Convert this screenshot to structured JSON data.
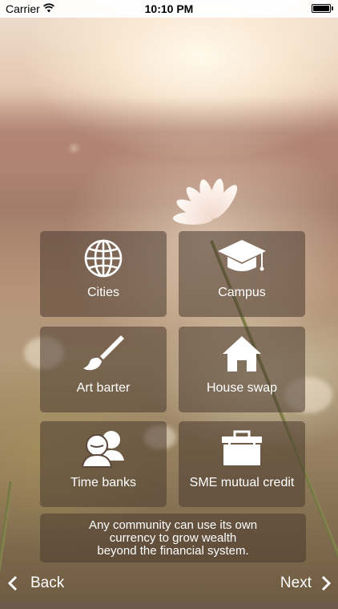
{
  "status_bar": {
    "carrier": "Carrier",
    "time": "10:10 PM",
    "icons": [
      "wifi-icon",
      "battery-icon"
    ],
    "battery_level": 1.0
  },
  "tiles": [
    {
      "label": "Cities",
      "icon": "globe-icon"
    },
    {
      "label": "Campus",
      "icon": "graduation-cap-icon"
    },
    {
      "label": "Art barter",
      "icon": "paintbrush-icon"
    },
    {
      "label": "House swap",
      "icon": "house-icon"
    },
    {
      "label": "Time banks",
      "icon": "people-icon"
    },
    {
      "label": "SME mutual credit",
      "icon": "briefcase-icon"
    }
  ],
  "info": {
    "lines": [
      "Any community can use its own",
      "currency to grow wealth",
      "beyond the financial system."
    ]
  },
  "nav": {
    "back_label": "Back",
    "next_label": "Next",
    "back_icon": "chevron-left-icon",
    "next_icon": "chevron-right-icon"
  },
  "colors": {
    "tile_background": "#4b3a30",
    "text": "#ffffff"
  }
}
